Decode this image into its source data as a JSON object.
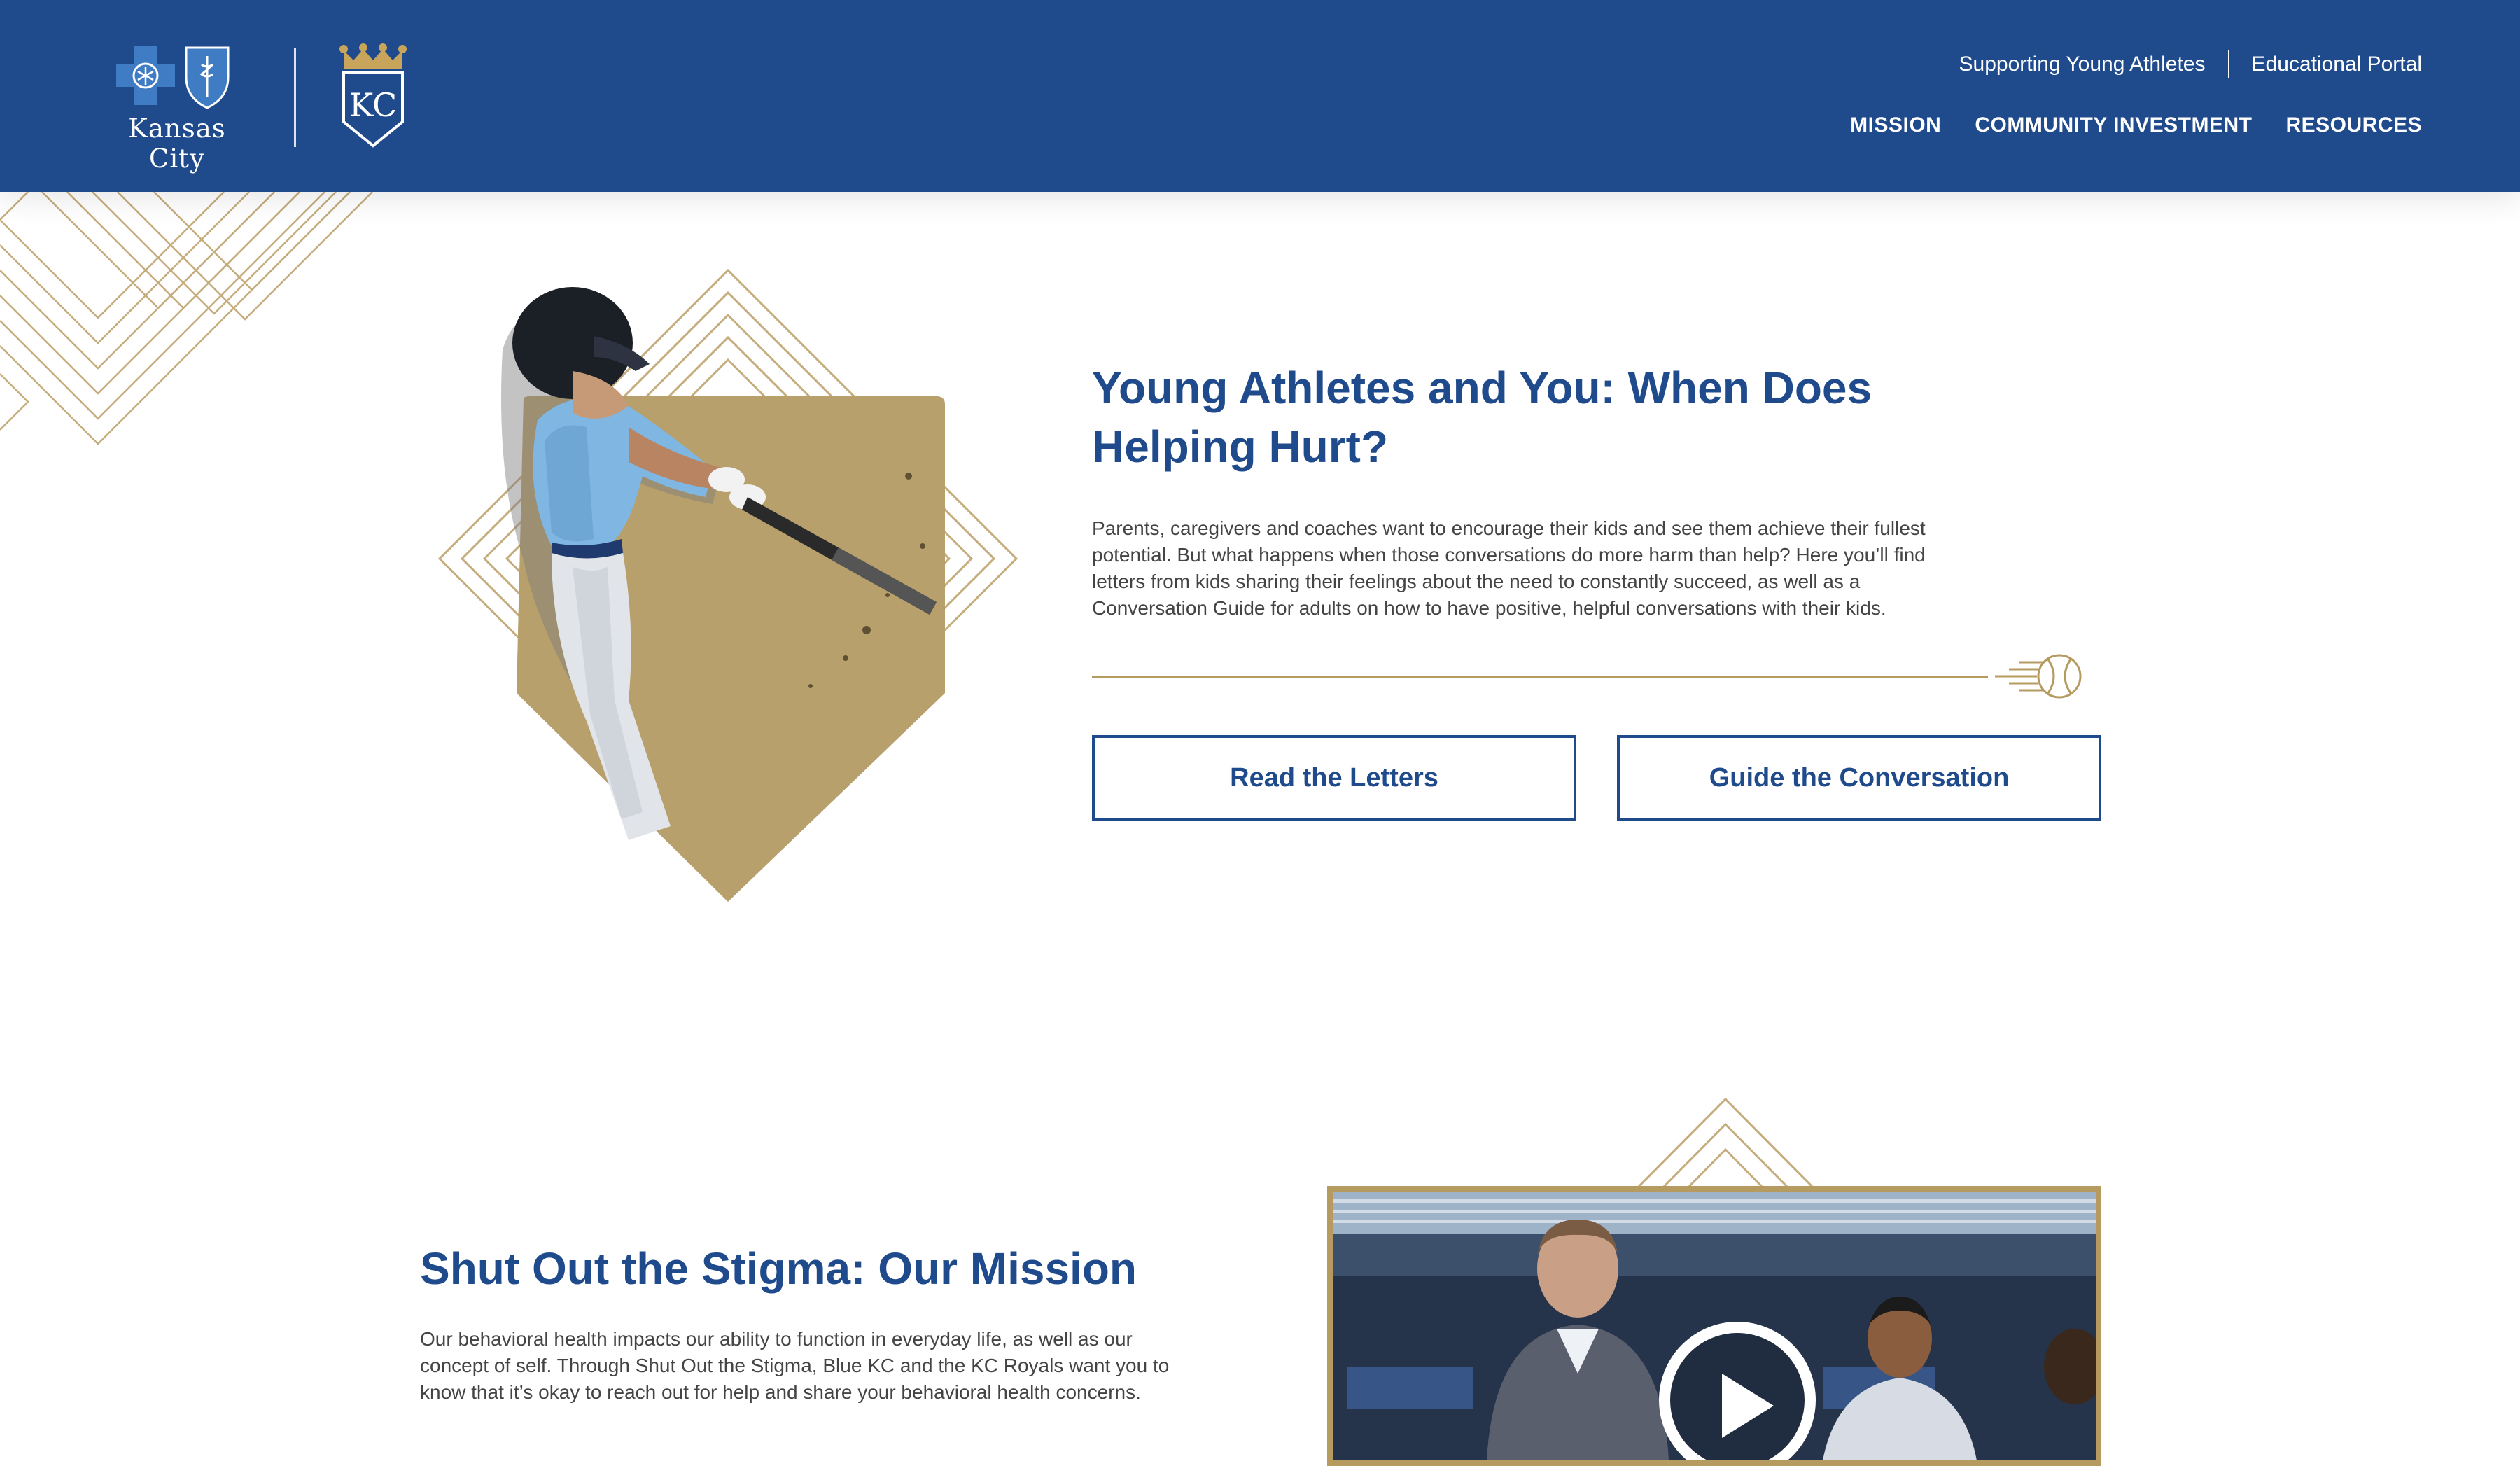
{
  "header": {
    "brand": {
      "city": "Kansas City",
      "crest_text": "KC"
    },
    "utility_nav": [
      {
        "label": "Supporting Young Athletes"
      },
      {
        "label": "Educational Portal"
      }
    ],
    "main_nav": [
      {
        "label": "MISSION"
      },
      {
        "label": "COMMUNITY INVESTMENT"
      },
      {
        "label": "RESOURCES"
      }
    ]
  },
  "hero": {
    "title": "Young Athletes and You: When Does Helping Hurt?",
    "body": "Parents, caregivers and coaches want to encourage their kids and see them achieve their fullest potential. But what happens when those conversations do more harm than help? Here you’ll find letters from kids sharing their feelings about the need to constantly succeed, as well as a Conversation Guide for adults on how to have positive, helpful conversations with their kids.",
    "buttons": {
      "read_letters": "Read the Letters",
      "guide_conversation": "Guide the Conversation"
    }
  },
  "mission": {
    "title": "Shut Out the Stigma: Our Mission",
    "body": "Our behavioral health impacts our ability to function in everyday life, as well as our concept of self. Through Shut Out the Stigma, Blue KC and the KC Royals want you to know that it’s okay to reach out for help and share your behavioral health concerns."
  },
  "colors": {
    "brand_blue": "#1f4a8c",
    "gold": "#b59b60",
    "body_text": "#444444",
    "jersey_blue": "#7fb7e2"
  },
  "icons": {
    "bcbs": "blue-cross-blue-shield-logo",
    "royals": "kc-royals-crest",
    "baseball": "baseball-icon",
    "play": "play-icon"
  }
}
